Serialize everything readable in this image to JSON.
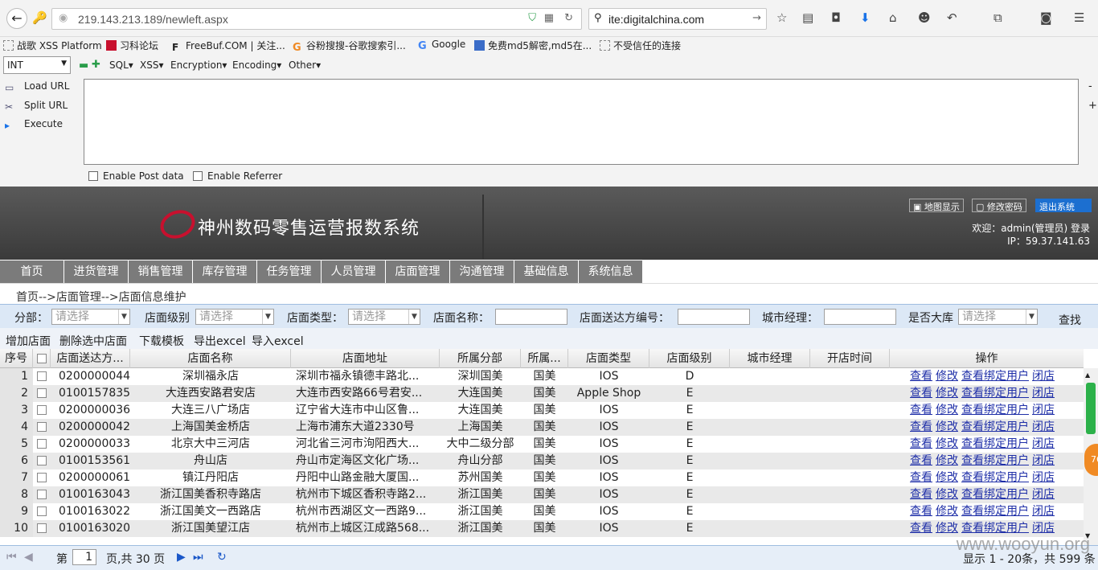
{
  "browser": {
    "url": "219.143.213.189/newleft.aspx",
    "search_value": "ite:digitalchina.com",
    "bookmarks": [
      "战歌 XSS Platform",
      "习科论坛",
      "FreeBuf.COM | 关注...",
      "谷粉搜搜-谷歌搜索引...",
      "Google",
      "免费md5解密,md5在...",
      "不受信任的连接"
    ]
  },
  "hackbar": {
    "type_select": "INT",
    "menus": [
      "SQL▾",
      "XSS▾",
      "Encryption▾",
      "Encoding▾",
      "Other▾"
    ],
    "load_url": "Load URL",
    "split_url": "Split URL",
    "execute": "Execute",
    "enable_post": "Enable Post data",
    "enable_referrer": "Enable Referrer"
  },
  "header": {
    "system_title": "神州数码零售运营报数系统",
    "map_btn": "地图显示",
    "change_pwd_btn": "修改密码",
    "logout_btn": "退出系统",
    "welcome": "欢迎：admin(管理员) 登录",
    "ip": "IP：59.37.141.63"
  },
  "menu": [
    "首页",
    "进货管理",
    "销售管理",
    "库存管理",
    "任务管理",
    "人员管理",
    "店面管理",
    "沟通管理",
    "基础信息",
    "系统信息"
  ],
  "breadcrumb": "首页-->店面管理-->店面信息维护",
  "filters": {
    "branch_label": "分部：",
    "branch_placeholder": "请选择",
    "level_label": "店面级别",
    "level_placeholder": "请选择",
    "type_label": "店面类型：",
    "type_placeholder": "请选择",
    "name_label": "店面名称：",
    "code_label": "店面送达方编号：",
    "manager_label": "城市经理：",
    "warehouse_label": "是否大库",
    "warehouse_placeholder": "请选择",
    "search_btn": "查找"
  },
  "toolbar": [
    "增加店面",
    "删除选中店面",
    "下载模板",
    "导出excel",
    "导入excel"
  ],
  "table": {
    "headers": [
      "序号",
      "",
      "店面送达方...",
      "店面名称",
      "店面地址",
      "所属分部",
      "所属...",
      "店面类型",
      "店面级别",
      "城市经理",
      "开店时间",
      "操作"
    ],
    "actions": [
      "查看",
      "修改",
      "查看绑定用户",
      "闭店"
    ],
    "rows": [
      {
        "no": "1",
        "code": "0200000044",
        "name": "深圳福永店",
        "addr": "深圳市福永镇德丰路北...",
        "branch": "深圳国美",
        "owner": "国美",
        "type": "IOS",
        "level": "D"
      },
      {
        "no": "2",
        "code": "0100157835",
        "name": "大连西安路君安店",
        "addr": "大连市西安路66号君安...",
        "branch": "大连国美",
        "owner": "国美",
        "type": "Apple Shop",
        "level": "E"
      },
      {
        "no": "3",
        "code": "0200000036",
        "name": "大连三八广场店",
        "addr": "辽宁省大连市中山区鲁...",
        "branch": "大连国美",
        "owner": "国美",
        "type": "IOS",
        "level": "E"
      },
      {
        "no": "4",
        "code": "0200000042",
        "name": "上海国美金桥店",
        "addr": "上海市浦东大道2330号",
        "branch": "上海国美",
        "owner": "国美",
        "type": "IOS",
        "level": "E"
      },
      {
        "no": "5",
        "code": "0200000033",
        "name": "北京大中三河店",
        "addr": "河北省三河市泃阳西大...",
        "branch": "大中二级分部",
        "owner": "国美",
        "type": "IOS",
        "level": "E"
      },
      {
        "no": "6",
        "code": "0100153561",
        "name": "舟山店",
        "addr": "舟山市定海区文化广场...",
        "branch": "舟山分部",
        "owner": "国美",
        "type": "IOS",
        "level": "E"
      },
      {
        "no": "7",
        "code": "0200000061",
        "name": "镇江丹阳店",
        "addr": "丹阳中山路金融大厦国...",
        "branch": "苏州国美",
        "owner": "国美",
        "type": "IOS",
        "level": "E"
      },
      {
        "no": "8",
        "code": "0100163043",
        "name": "浙江国美香积寺路店",
        "addr": "杭州市下城区香积寺路2...",
        "branch": "浙江国美",
        "owner": "国美",
        "type": "IOS",
        "level": "E"
      },
      {
        "no": "9",
        "code": "0100163022",
        "name": "浙江国美文一西路店",
        "addr": "杭州市西湖区文一西路9...",
        "branch": "浙江国美",
        "owner": "国美",
        "type": "IOS",
        "level": "E"
      },
      {
        "no": "10",
        "code": "0100163020",
        "name": "浙江国美望江店",
        "addr": "杭州市上城区江成路568...",
        "branch": "浙江国美",
        "owner": "国美",
        "type": "IOS",
        "level": "E"
      }
    ]
  },
  "pager": {
    "page_prefix": "第",
    "page_value": "1",
    "page_suffix": "页,共 30 页",
    "summary": "显示 1 - 20条，共 599 条"
  },
  "watermark": "www.wooyun.org",
  "badge": "76"
}
